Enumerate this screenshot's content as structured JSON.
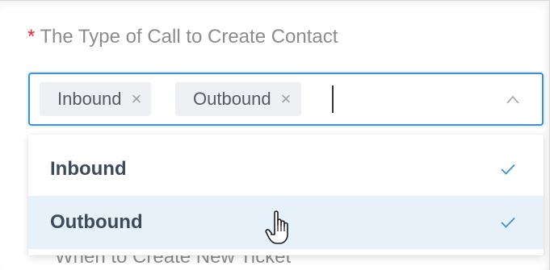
{
  "field": {
    "required_marker": "*",
    "label": "The Type of Call to Create Contact"
  },
  "select": {
    "selected_tags": [
      {
        "label": "Inbound",
        "remove_icon": "×"
      },
      {
        "label": "Outbound",
        "remove_icon": "×"
      }
    ],
    "expand_icon": "chevron-up-icon"
  },
  "dropdown": {
    "options": [
      {
        "label": "Inbound",
        "selected": true,
        "highlighted": false
      },
      {
        "label": "Outbound",
        "selected": true,
        "highlighted": true
      }
    ]
  },
  "next_field": {
    "label": "When to Create New Ticket"
  },
  "colors": {
    "required": "#f5222d",
    "focus_border": "#3d8fd6",
    "check": "#3d8fd6",
    "highlight_bg": "#e6f1fa",
    "tag_bg": "#eef0f3"
  }
}
